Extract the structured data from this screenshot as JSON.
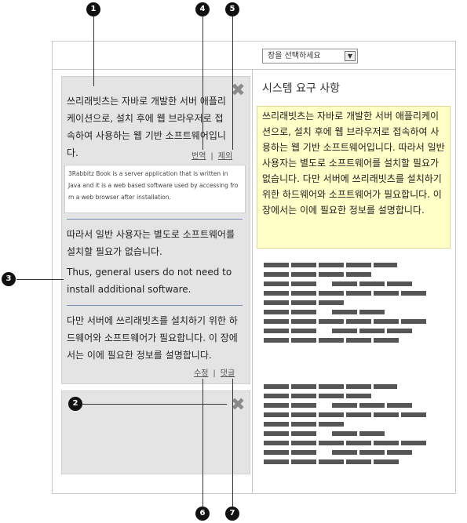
{
  "toolbar": {
    "chapter_select": "장을 선택하세요",
    "select_arrow": "▼"
  },
  "panel1": {
    "source_text": "쓰리래빗츠는 자바로 개발한 서버 애플리케이션으로, 설치 후에 웹 브라우저로 접속하여 사용하는 웹 기반 소프트웨어입니다.",
    "link_translate": "번역",
    "link_delete": "제외",
    "translation": "3Rabbitz Book is a server application that is written in Java and it is a web based software used by accessing fro m a web browser after installation.",
    "para2_ko": "따라서 일반 사용자는 별도로 소프트웨어를 설치할 필요가 없습니다.",
    "para2_en": "Thus, general users do not need to install additional software.",
    "para3": "다만 서버에 쓰리래빗츠를 설치하기 위한 하드웨어와 소프트웨어가 필요합니다. 이 장에서는 이에 필요한 정보를 설명합니다.",
    "link_edit": "수정",
    "link_comment": "댓글",
    "link_sep": "|",
    "close_icon": "✖"
  },
  "panel2": {
    "close_icon": "✖"
  },
  "right": {
    "title": "시스템 요구 사항",
    "highlight": "쓰리래빗츠는 자바로 개발한 서버 애플리케이션으로, 설치 후에 웹 브라우저로 접속하여 사용하는 웹 기반 소프트웨어입니다. 따라서 일반 사용자는 별도로 소프트웨어를 설치할 필요가 없습니다. 다만 서버에 쓰리래빗츠를 설치하기 위한 하드웨어와 소프트웨어가 필요합니다. 이 장에서는 이에 필요한 정보를 설명합니다."
  },
  "callouts": [
    "1",
    "2",
    "3",
    "4",
    "5",
    "6",
    "7"
  ],
  "colors": {
    "panel_bg": "#e4e4e4",
    "highlight_bg": "#ffffc7",
    "placeholder_bar": "#555555",
    "callout": "#111111"
  }
}
